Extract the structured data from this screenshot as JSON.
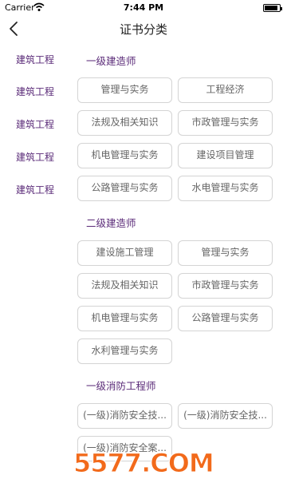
{
  "status_bar": {
    "carrier": "Carrier",
    "time": "7:44 PM",
    "battery_level": 0.9
  },
  "nav": {
    "title": "证书分类"
  },
  "sidebar": {
    "items": [
      {
        "label": "建筑工程"
      },
      {
        "label": "建筑工程"
      },
      {
        "label": "建筑工程"
      },
      {
        "label": "建筑工程"
      },
      {
        "label": "建筑工程"
      }
    ]
  },
  "sections": [
    {
      "title": "一级建造师",
      "items": [
        "管理与实务",
        "工程经济",
        "法规及相关知识",
        "市政管理与实务",
        "机电管理与实务",
        "建设项目管理",
        "公路管理与实务",
        "水电管理与实务"
      ]
    },
    {
      "title": "二级建造师",
      "items": [
        "建设施工管理",
        "管理与实务",
        "法规及相关知识",
        "市政管理与实务",
        "机电管理与实务",
        "公路管理与实务",
        "水利管理与实务"
      ]
    },
    {
      "title": "一级消防工程师",
      "items": [
        "(一级)消防安全技...",
        "(一级)消防安全技...",
        "(一级)消防安全案..."
      ]
    }
  ],
  "watermark": {
    "text": "5577.COM"
  },
  "colors": {
    "accent": "#5a2a78",
    "chip_border": "#d4d4d4",
    "watermark": "#f26a1b"
  }
}
